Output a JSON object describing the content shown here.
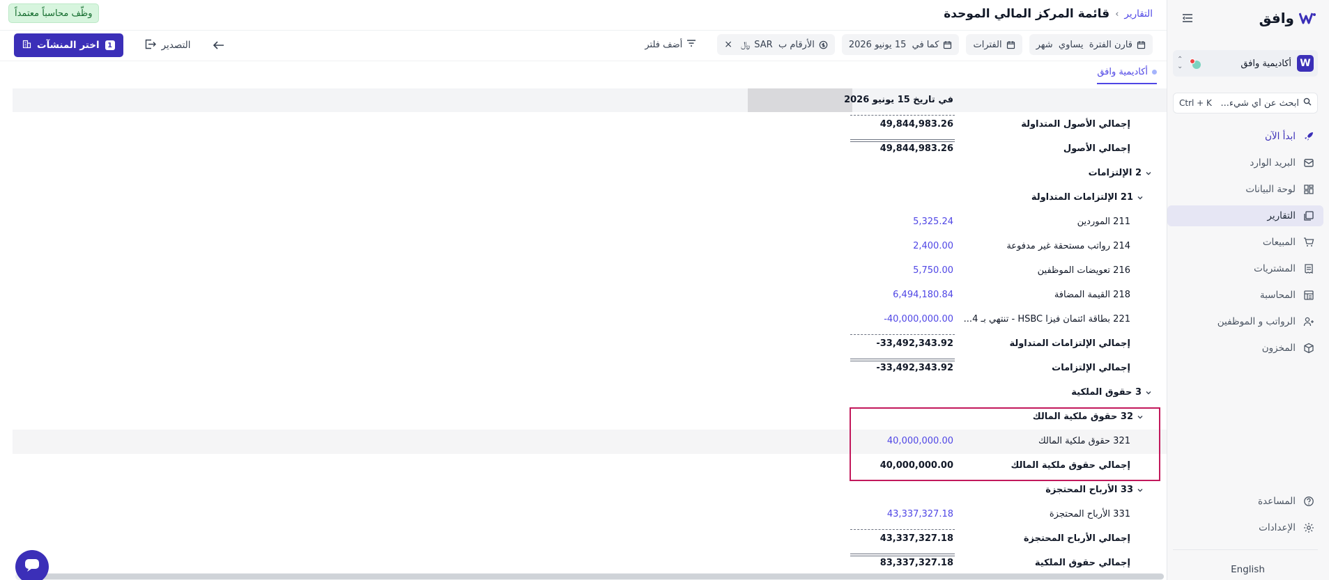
{
  "brand": {
    "name": "وافق"
  },
  "org": {
    "name": "أكاديمية وافق",
    "logo_letter": "W"
  },
  "search": {
    "placeholder": "ابحث عن أي شيء...",
    "shortcut": "Ctrl + K"
  },
  "nav": {
    "items": [
      {
        "label": "ابدأ الآن",
        "icon": "rocket-icon"
      },
      {
        "label": "البريد الوارد",
        "icon": "inbox-icon"
      },
      {
        "label": "لوحة البيانات",
        "icon": "dashboard-icon"
      },
      {
        "label": "التقارير",
        "icon": "reports-icon"
      },
      {
        "label": "المبيعات",
        "icon": "cart-icon"
      },
      {
        "label": "المشتريات",
        "icon": "receipt-icon"
      },
      {
        "label": "المحاسبة",
        "icon": "ledger-icon"
      },
      {
        "label": "الرواتب و الموظفين",
        "icon": "users-icon"
      },
      {
        "label": "المخزون",
        "icon": "box-icon"
      }
    ],
    "bottom": [
      {
        "label": "المساعدة",
        "icon": "help-icon"
      },
      {
        "label": "الإعدادات",
        "icon": "gear-icon"
      }
    ],
    "language": "English"
  },
  "header": {
    "breadcrumb": "التقارير",
    "title": "قائمة المركز المالي الموحدة",
    "hire_badge": "وظّف محاسباً معتمداً"
  },
  "filters": {
    "compare": "قارن الفترة  يساوي  شهر",
    "periods": "الفترات",
    "as_of": "كما في  15 يونيو 2026",
    "currency": "الأرقام ب  SAR",
    "add_filter": "أضف فلتر"
  },
  "actions": {
    "export": "التصدير",
    "select_entities": "اختر المنشآت",
    "entities_count": "1"
  },
  "tabs": [
    {
      "label": "أكاديمية وافق"
    }
  ],
  "report": {
    "column_header": "في تاريخ 15 يونيو 2026",
    "rows": [
      {
        "label": "إجمالي الأصول المتداولة",
        "value": "49,844,983.26"
      },
      {
        "label": "إجمالي الأصول",
        "value": "49,844,983.26"
      },
      {
        "label": "2 الإلتزامات",
        "value": ""
      },
      {
        "label": "21 الإلتزامات المتداولة",
        "value": ""
      },
      {
        "label": "211 الموردين",
        "value": "5,325.24"
      },
      {
        "label": "214 رواتب مستحقة غير مدفوعة",
        "value": "2,400.00"
      },
      {
        "label": "216 تعويضات الموظفين",
        "value": "5,750.00"
      },
      {
        "label": "218 القيمة المضافة",
        "value": "6,494,180.84"
      },
      {
        "label": "221 بطاقة ائتمان فيزا HSBC - تنتهي بـ 4...",
        "value": "-40,000,000.00"
      },
      {
        "label": "إجمالي الإلتزامات المتداولة",
        "value": "-33,492,343.92"
      },
      {
        "label": "إجمالي الإلتزامات",
        "value": "-33,492,343.92"
      },
      {
        "label": "3 حقوق الملكية",
        "value": ""
      },
      {
        "label": "32 حقوق ملكية المالك",
        "value": ""
      },
      {
        "label": "321 حقوق ملكية المالك",
        "value": "40,000,000.00"
      },
      {
        "label": "إجمالي حقوق ملكية المالك",
        "value": "40,000,000.00"
      },
      {
        "label": "33 الأرباح المحتجزة",
        "value": ""
      },
      {
        "label": "331 الأرباح المحتجزة",
        "value": "43,337,327.18"
      },
      {
        "label": "إجمالي الأرباح المحتجزة",
        "value": "43,337,327.18"
      },
      {
        "label": "إجمالي حقوق الملكية",
        "value": "83,337,327.18"
      }
    ]
  },
  "colors": {
    "primary": "#3b2fb8",
    "link": "#4f46e5",
    "highlight_border": "#c2185b",
    "badge_bg": "#d7f5de"
  }
}
